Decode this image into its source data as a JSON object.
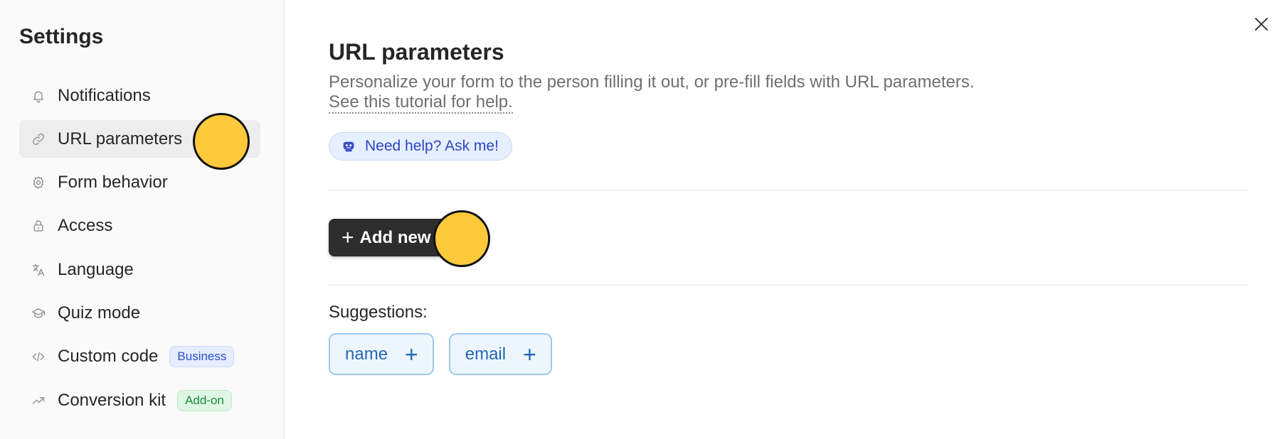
{
  "sidebar": {
    "title": "Settings",
    "items": [
      {
        "label": "Notifications",
        "icon": "bell-icon",
        "active": false
      },
      {
        "label": "URL parameters",
        "icon": "link-icon",
        "active": true
      },
      {
        "label": "Form behavior",
        "icon": "gear-icon",
        "active": false
      },
      {
        "label": "Access",
        "icon": "lock-icon",
        "active": false
      },
      {
        "label": "Language",
        "icon": "translate-icon",
        "active": false
      },
      {
        "label": "Quiz mode",
        "icon": "graduation-cap-icon",
        "active": false
      },
      {
        "label": "Custom code",
        "icon": "code-icon",
        "active": false,
        "badge": "Business"
      },
      {
        "label": "Conversion kit",
        "icon": "trending-up-icon",
        "active": false,
        "badge": "Add-on"
      }
    ]
  },
  "main": {
    "title": "URL parameters",
    "description": "Personalize your form to the person filling it out, or pre-fill fields with URL parameters.",
    "tutorial_link": "See this tutorial for help.",
    "help_button": "Need help? Ask me!",
    "add_button": "Add new",
    "suggestions_label": "Suggestions:",
    "suggestions": [
      "name",
      "email"
    ]
  },
  "colors": {
    "accent_dark": "#2d2d2d",
    "chip_blue": "#2367b4",
    "help_blue": "#2b45c4",
    "cursor_highlight": "#fec93b"
  }
}
